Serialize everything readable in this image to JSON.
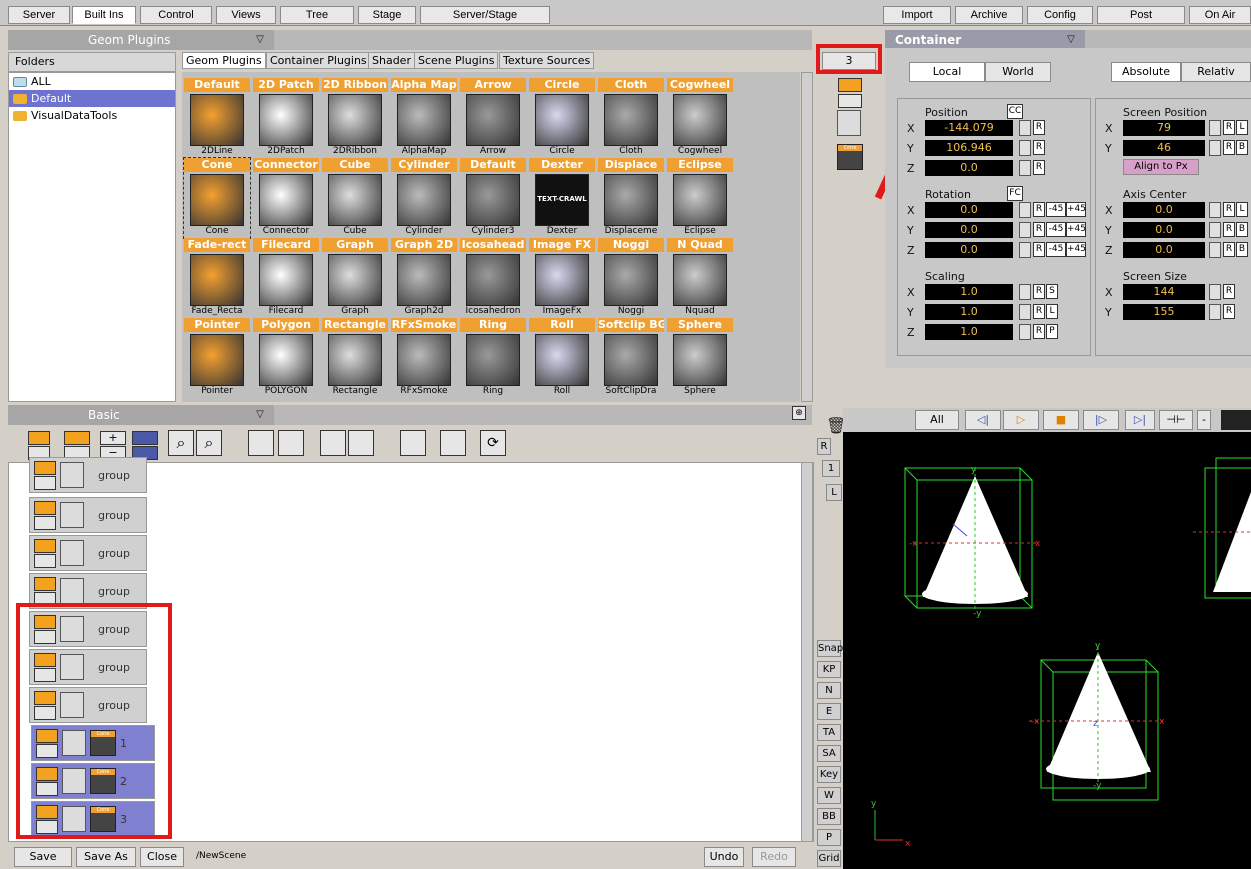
{
  "menu": {
    "left": [
      "Server",
      "Built Ins",
      "Control",
      "Views",
      "Tree",
      "Stage",
      "Server/Stage"
    ],
    "right": [
      "Import",
      "Archive",
      "Config",
      "Post",
      "On Air"
    ]
  },
  "plugins_dropdown": "Geom Plugins",
  "folders": {
    "header": "Folders",
    "items": [
      "ALL",
      "Default",
      "VisualDataTools"
    ]
  },
  "plugin_tabs": [
    "Geom Plugins",
    "Container Plugins",
    "Shader",
    "Scene Plugins",
    "Texture Sources"
  ],
  "plugins": [
    [
      "Default",
      "2DLine"
    ],
    [
      "2D Patch",
      "2DPatch"
    ],
    [
      "2D Ribbon",
      "2DRibbon"
    ],
    [
      "Alpha Map",
      "AlphaMap"
    ],
    [
      "Arrow",
      "Arrow"
    ],
    [
      "Circle",
      "Circle"
    ],
    [
      "Cloth",
      "Cloth"
    ],
    [
      "Cogwheel",
      "Cogwheel"
    ],
    [
      "Cone",
      "Cone"
    ],
    [
      "Connector",
      "Connector"
    ],
    [
      "Cube",
      "Cube"
    ],
    [
      "Cylinder",
      "Cylinder"
    ],
    [
      "Default",
      "Cylinder3"
    ],
    [
      "Dexter",
      "Dexter"
    ],
    [
      "Displace",
      "Displaceme"
    ],
    [
      "Eclipse",
      "Eclipse"
    ],
    [
      "Fade-rect",
      "Fade_Recta"
    ],
    [
      "Filecard",
      "Filecard"
    ],
    [
      "Graph",
      "Graph"
    ],
    [
      "Graph 2D",
      "Graph2d"
    ],
    [
      "Icosahead",
      "Icosahedron"
    ],
    [
      "Image FX",
      "ImageFx"
    ],
    [
      "Noggi",
      "Noggi"
    ],
    [
      "N Quad",
      "Nquad"
    ],
    [
      "Pointer",
      "Pointer"
    ],
    [
      "Polygon",
      "POLYGON"
    ],
    [
      "Rectangle",
      "Rectangle"
    ],
    [
      "RFxSmoke",
      "RFxSmoke"
    ],
    [
      "Ring",
      "Ring"
    ],
    [
      "Roll",
      "Roll"
    ],
    [
      "Softclip BG",
      "SoftClipDra"
    ],
    [
      "Sphere",
      "Sphere"
    ]
  ],
  "dexter_text": "TEXT-CRAWL",
  "tree_dropdown": "Basic",
  "tree_nodes": [
    {
      "label": "group"
    },
    {
      "label": "group"
    },
    {
      "label": "group"
    },
    {
      "label": "group"
    },
    {
      "label": "group"
    },
    {
      "label": "group"
    },
    {
      "label": "group"
    },
    {
      "label": "1",
      "cone": "Cone"
    },
    {
      "label": "2",
      "cone": "Cone"
    },
    {
      "label": "3",
      "cone": "Cone"
    }
  ],
  "bottom": {
    "save": "Save",
    "save_as": "Save As",
    "close": "Close",
    "scene": "/NewScene",
    "undo": "Undo",
    "redo": "Redo"
  },
  "mid": {
    "counter": "3",
    "cone_thumb": "Cone",
    "r": "R",
    "one": "1",
    "l": "L"
  },
  "viewport_buttons": [
    "Snap",
    "KP",
    "N",
    "E",
    "TA",
    "SA",
    "Key",
    "W",
    "BB",
    "P",
    "Grid"
  ],
  "playback": {
    "all": "All"
  },
  "container": {
    "title": "Container",
    "local": "Local",
    "world": "World",
    "absolute": "Absolute",
    "relative": "Relativ",
    "position_label": "Position",
    "pos_x": "-144.079",
    "pos_y": "106.946",
    "pos_z": "0.0",
    "cc": "CC",
    "rotation_label": "Rotation",
    "rot_x": "0.0",
    "rot_y": "0.0",
    "rot_z": "0.0",
    "fc": "FC",
    "scaling_label": "Scaling",
    "sc_x": "1.0",
    "sc_y": "1.0",
    "sc_z": "1.0",
    "screen_pos_label": "Screen Position",
    "sp_x": "79",
    "sp_y": "46",
    "align": "Align to Px",
    "axis_center_label": "Axis Center",
    "ac_x": "0.0",
    "ac_y": "0.0",
    "ac_z": "0.0",
    "screen_size_label": "Screen Size",
    "ss_x": "144",
    "ss_y": "155",
    "x": "X",
    "y": "Y",
    "z": "Z",
    "r": "R",
    "s": "S",
    "l": "L",
    "p": "P",
    "b": "B",
    "m45": "-45",
    "p45": "+45"
  },
  "axis_labels": {
    "x": "x",
    "y": "y",
    "negx": "-x",
    "negy": "-y",
    "z": "z"
  }
}
